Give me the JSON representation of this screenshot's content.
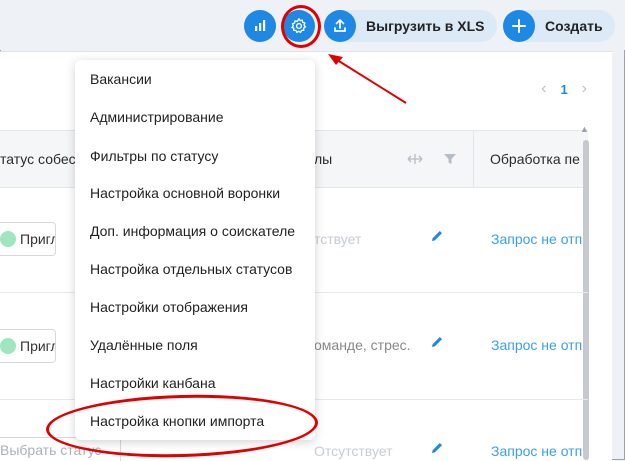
{
  "toolbar": {
    "stats_icon": "bar-chart-icon",
    "settings_icon": "gear-icon",
    "export_icon": "upload-icon",
    "export_label": "Выгрузить в XLS",
    "create_icon": "plus-icon",
    "create_label": "Создать"
  },
  "pager": {
    "prev": "‹",
    "page": "1",
    "next": "›"
  },
  "table": {
    "headers": [
      "татус собесе",
      "лы",
      "Обработка пе"
    ],
    "rows": [
      {
        "status": "Приглаш",
        "middle": "тствует",
        "action": "Запрос не отп"
      },
      {
        "status": "Приглаш",
        "middle": "оманде, стрес...",
        "action": "Запрос не отп"
      },
      {
        "status_placeholder": "Выбрать статус",
        "middle": "Отсутствует",
        "action": "Запрос не отп"
      }
    ]
  },
  "menu": {
    "items": [
      "Вакансии",
      "Администрирование",
      "Фильтры по статусу",
      "Настройка основной воронки",
      "Доп. информация о соискателе",
      "Настройка отдельных статусов",
      "Настройки отображения",
      "Удалённые поля",
      "Настройки канбана",
      "Настройка кнопки импорта"
    ]
  },
  "colors": {
    "accent": "#1e88e5",
    "highlight": "#e00000",
    "status_dot": "#9ee6c0",
    "link": "#3aa0e8"
  }
}
